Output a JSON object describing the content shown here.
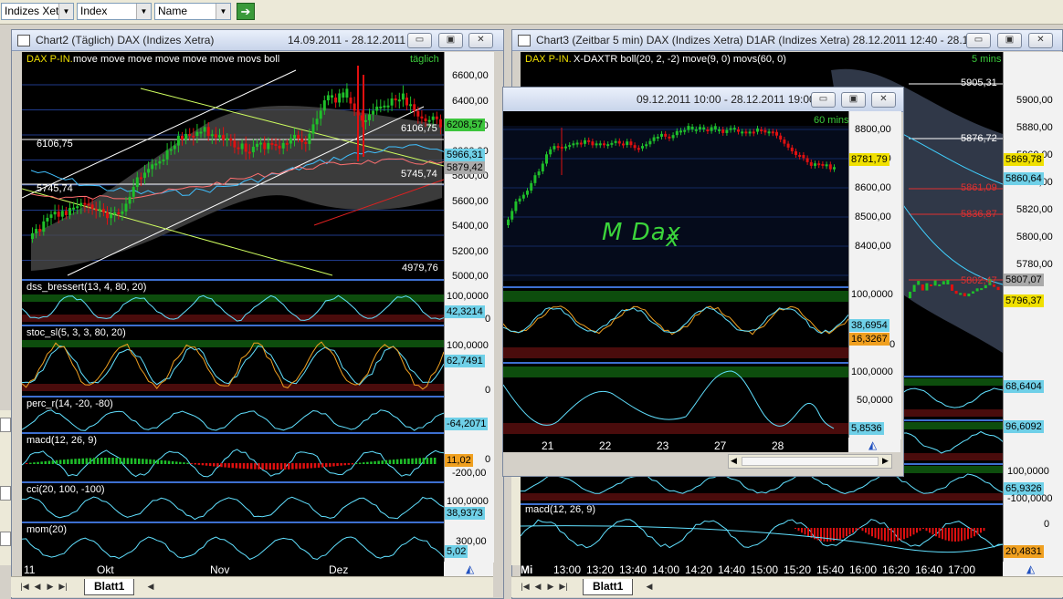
{
  "toolbar": {
    "exchange": "Indizes Xetra",
    "type": "Index",
    "sort": "Name",
    "go_icon": "arrow-right-icon"
  },
  "chart2": {
    "title": "Chart2 (Täglich)  DAX (Indizes Xetra)",
    "dates": "14.09.2011 - 28.12.2011",
    "buttons": {
      "min": "▭",
      "max": "▣",
      "close": "✕"
    },
    "legend": "DAX P-IN. move move move move move move movs boll",
    "period": "täglich",
    "price_ticks": [
      "6600,00",
      "6400,00",
      "6200,00",
      "6000,00",
      "5800,00",
      "5600,00",
      "5400,00",
      "5200,00",
      "5000,00"
    ],
    "price_boxes": {
      "top": "6208,57",
      "mid1": "5966,31",
      "mid2": "5879,42",
      "mid3": "5745,74"
    },
    "hlines": {
      "a": "6106,75",
      "b": "5745,74",
      "c": "6106,75",
      "d": "5745,74",
      "low": "4979,76"
    },
    "indicators": [
      {
        "name": "dss_bressert(13, 4, 80, 20)",
        "top": "100,0000",
        "box": "42,3214",
        "bottom": "0"
      },
      {
        "name": "stoc_sl(5, 3, 3, 80, 20)",
        "top": "100,0000",
        "box": "62,7491",
        "bottom": "0"
      },
      {
        "name": "perc_r(14, -20, -80)",
        "top": "",
        "box": "-64,2071",
        "bottom": ""
      },
      {
        "name": "macd(12, 26, 9)",
        "top": "",
        "box": "11,02",
        "bottom": "-200,00"
      },
      {
        "name": "cci(20, 100, -100)",
        "top": "100,0000",
        "box": "38,9373",
        "bottom": ""
      },
      {
        "name": "mom(20)",
        "top": "300,00",
        "box": "5,02",
        "bottom": ""
      }
    ],
    "macd_zero": "0",
    "xlabels": [
      "11",
      "Okt",
      "Nov",
      "Dez"
    ],
    "sheet": "Blatt1"
  },
  "chart3": {
    "title": "Chart3 (Zeitbar 5 min)  DAX (Indizes Xetra) D1AR (Indizes Xetra) 28.12.2011 12:40 - 28.1...",
    "legend": "DAX P-IN.  X-DAXTR boll(20, 2, -2) move(9, 0) movs(60, 0)",
    "period": "5 mins",
    "price_ticks": [
      "5900,00",
      "5880,00",
      "5860,00",
      "5840,00",
      "5820,00",
      "5800,00",
      "5780,00"
    ],
    "levels": [
      "5905,31",
      "5876,72",
      "5861,09",
      "5836,87",
      "5802,47"
    ],
    "boxes": {
      "b1": "5869,78",
      "b2": "5860,64",
      "b3": "5807,07",
      "b4": "5796,37"
    },
    "indicator_boxes": [
      "68,6404",
      "96,6092",
      "65,9326"
    ],
    "indicator_ticks": [
      "100,0000",
      "0",
      "100,0000",
      "-100,0000"
    ],
    "macd_label": "macd(12, 26, 9)",
    "macd_box": "20,4831",
    "macd_zero": "0",
    "xlabels": [
      "Mi",
      "13:00",
      "13:20",
      "13:40",
      "14:00",
      "14:20",
      "14:40",
      "15:00",
      "15:20",
      "15:40",
      "16:00",
      "16:20",
      "16:40",
      "17:00"
    ],
    "sheet": "Blatt1"
  },
  "popup": {
    "dates": "09.12.2011 10:00 - 28.12.2011 19:00",
    "period": "60 mins",
    "price_ticks": [
      "8800,00",
      "8700,00",
      "8600,00",
      "8500,00",
      "8400,00"
    ],
    "price_box": "8781,79",
    "handwriting": "M Dax",
    "osc1": {
      "top": "100,0000",
      "box1": "38,6954",
      "box2": "16,3267",
      "bottom": "0"
    },
    "osc2": {
      "top": "100,0000",
      "mid": "50,0000",
      "box": "5,8536",
      "bottom": "0"
    },
    "xlabels": [
      "21",
      "22",
      "23",
      "27",
      "28"
    ]
  },
  "colors": {
    "bg": "#000000",
    "grid": "#1f3a8a",
    "up": "#1fbf2a",
    "down": "#e01010",
    "panel_green": "#0d4d0d",
    "panel_red": "#4a0c0c"
  }
}
